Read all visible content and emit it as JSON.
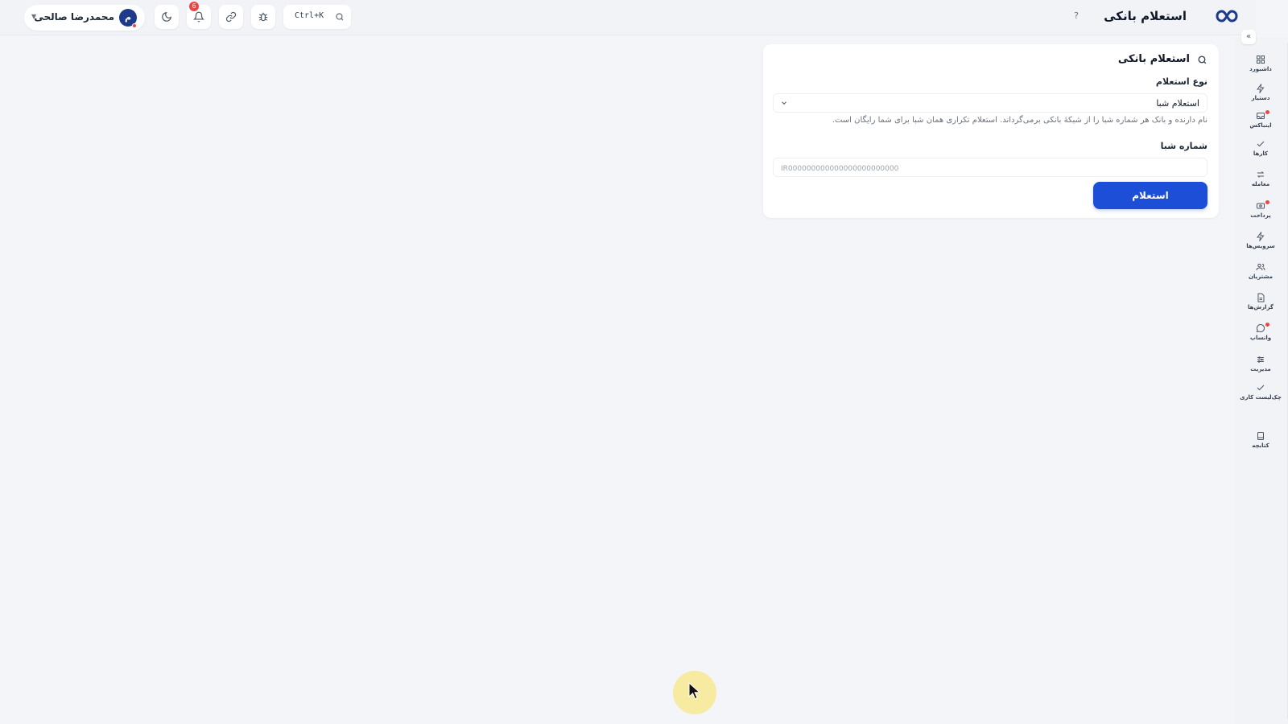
{
  "header": {
    "title": "استعلام بانکی",
    "help_icon": "?",
    "user": {
      "name": "محمدرضا صالحی",
      "avatar_initial": "م"
    },
    "notifications_count": "6",
    "search_shortcut": "Ctrl+K"
  },
  "sidebar": {
    "collapse_icon": "«",
    "items": [
      {
        "label": "داشبورد",
        "icon": "grid-icon"
      },
      {
        "label": "دستیار",
        "icon": "bolt-icon"
      },
      {
        "label": "اینباکس",
        "icon": "inbox-icon",
        "dot": true
      },
      {
        "label": "کارها",
        "icon": "check-icon"
      },
      {
        "label": "معامله",
        "icon": "exchange-icon"
      },
      {
        "label": "پرداخت",
        "icon": "payment-icon",
        "dot": true
      },
      {
        "label": "سرویس‌ها",
        "icon": "bolt-icon"
      },
      {
        "label": "مشتریان",
        "icon": "users-icon"
      },
      {
        "label": "گزارش‌ها",
        "icon": "report-icon"
      },
      {
        "label": "واتساپ",
        "icon": "chat-icon",
        "dot": true
      },
      {
        "label": "مدیریت",
        "icon": "sliders-icon"
      },
      {
        "label": "چک‌لیست کاری",
        "icon": "check-icon"
      },
      {
        "label": "کتابچه",
        "icon": "book-icon"
      }
    ]
  },
  "card": {
    "title": "استعلام بانکی",
    "inquiry_type_label": "نوع استعلام",
    "inquiry_type_value": "استعلام شبا",
    "hint": "نام دارنده و بانک هر شماره شبا را از شبکهٔ بانکی برمی‌گرداند. استعلام تکراری همان شبا برای شما رایگان است.",
    "iban_label": "شماره شبا",
    "iban_placeholder": "IR000000000000000000000000",
    "submit_label": "استعلام"
  },
  "colors": {
    "accent": "#1d4ed8",
    "badge": "#ef4444",
    "background": "#f3f5f9"
  }
}
